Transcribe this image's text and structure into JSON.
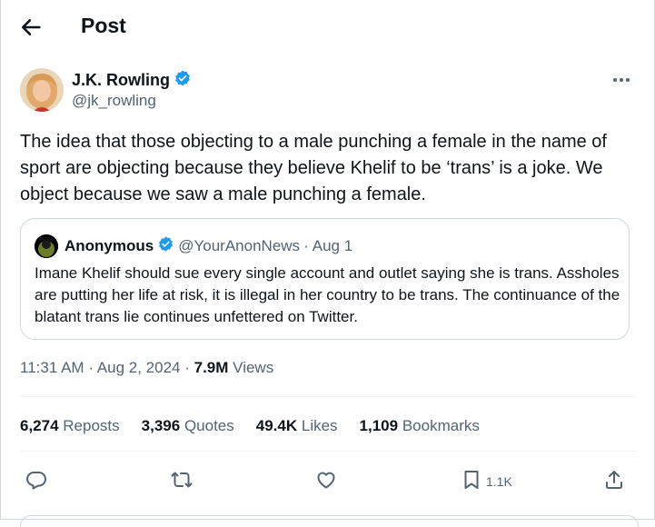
{
  "header": {
    "title": "Post"
  },
  "author": {
    "name": "J.K. Rowling",
    "handle": "@jk_rowling"
  },
  "tweet": {
    "text": "The idea that those objecting to a male punching a female in the name of sport are objecting because they believe Khelif to be ‘trans’ is a joke. We object because we saw a male punching a female."
  },
  "quote": {
    "name": "Anonymous",
    "handle": "@YourAnonNews",
    "separator": "·",
    "date": "Aug 1",
    "text": "Imane Khelif should sue every single account and outlet saying she is trans. Assholes are putting her life at risk, it is illegal in her country to be trans. The continuance of the blatant trans lie continues unfettered on Twitter."
  },
  "meta": {
    "time": "11:31 AM",
    "sep1": "·",
    "date": "Aug 2, 2024",
    "sep2": "·",
    "views_count": "7.9M",
    "views_label": "Views"
  },
  "stats": [
    {
      "count": "6,274",
      "label": "Reposts"
    },
    {
      "count": "3,396",
      "label": "Quotes"
    },
    {
      "count": "49.4K",
      "label": "Likes"
    },
    {
      "count": "1,109",
      "label": "Bookmarks"
    }
  ],
  "actions": {
    "reply": "reply-icon",
    "repost": "repost-icon",
    "like": "like-icon",
    "bookmark": "bookmark-icon",
    "bookmark_count": "1.1K",
    "share": "share-icon"
  },
  "colors": {
    "verified": "#1d9bf0",
    "muted": "#536471",
    "text": "#0f1419"
  }
}
